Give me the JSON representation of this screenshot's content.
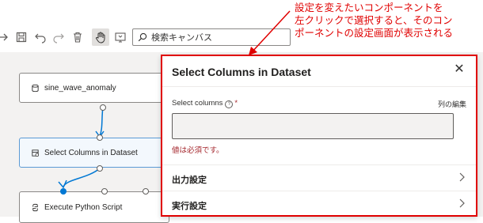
{
  "annotation": {
    "lines": [
      "設定を変えたいコンポーネントを",
      "左クリックで選択すると、そのコン",
      "ポーネントの設定画面が表示される"
    ],
    "color": "#e00000"
  },
  "toolbar": {
    "search_placeholder": "検索キャンバス",
    "icons": [
      "redo-icon",
      "save-icon",
      "undo-icon",
      "redo-icon",
      "delete-icon",
      "pan-hand-icon",
      "fit-screen-icon",
      "search-icon"
    ]
  },
  "canvas": {
    "nodes": [
      {
        "label": "sine_wave_anomaly",
        "icon": "database-icon"
      },
      {
        "label": "Select Columns in Dataset",
        "icon": "table-icon",
        "selected": true
      },
      {
        "label": "Execute Python Script",
        "icon": "python-icon"
      }
    ],
    "accent": "#0078d4"
  },
  "panel": {
    "title": "Select Columns in Dataset",
    "field_label": "Select columns",
    "required_mark": "*",
    "edit_link": "列の編集",
    "error_text": "値は必須です。",
    "sections": [
      {
        "title": "出力設定"
      },
      {
        "title": "実行設定"
      }
    ],
    "border_color": "#e00000"
  }
}
